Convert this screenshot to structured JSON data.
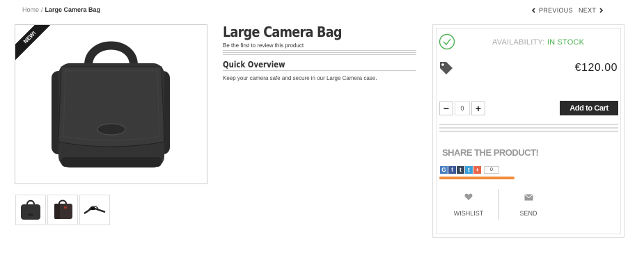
{
  "breadcrumb": {
    "home": "Home",
    "separator": "/",
    "current": "Large Camera Bag"
  },
  "pager": {
    "previous": "PREVIOUS",
    "next": "NEXT"
  },
  "product": {
    "badge": "NEW!",
    "title": "Large Camera Bag",
    "review_link": "Be the first to review this product",
    "quick_overview_title": "Quick Overview",
    "quick_overview_text": "Keep your camera safe and secure in our Large Camera case.",
    "availability_label": "AVAILABILITY:",
    "availability_value": "IN STOCK",
    "price": "€120.00",
    "qty_value": "0",
    "qty_decrease": "−",
    "qty_increase": "+",
    "add_to_cart": "Add to Cart"
  },
  "share": {
    "title": "SHARE THE PRODUCT!",
    "icons": [
      {
        "name": "google-icon",
        "glyph": "G",
        "color": "#4a7fc1"
      },
      {
        "name": "facebook-icon",
        "glyph": "f",
        "color": "#3b5998"
      },
      {
        "name": "tumblr-icon",
        "glyph": "t",
        "color": "#35465c"
      },
      {
        "name": "twitter-icon",
        "glyph": "t",
        "color": "#3ba0d9"
      },
      {
        "name": "plus-icon",
        "glyph": "+",
        "color": "#e8664a"
      }
    ],
    "count": "0"
  },
  "actions": {
    "wishlist": "WISHLIST",
    "send": "SEND"
  },
  "colors": {
    "accent_orange": "#f08c3c",
    "in_stock_green": "#4caf50",
    "button_dark": "#2b2b2b"
  }
}
